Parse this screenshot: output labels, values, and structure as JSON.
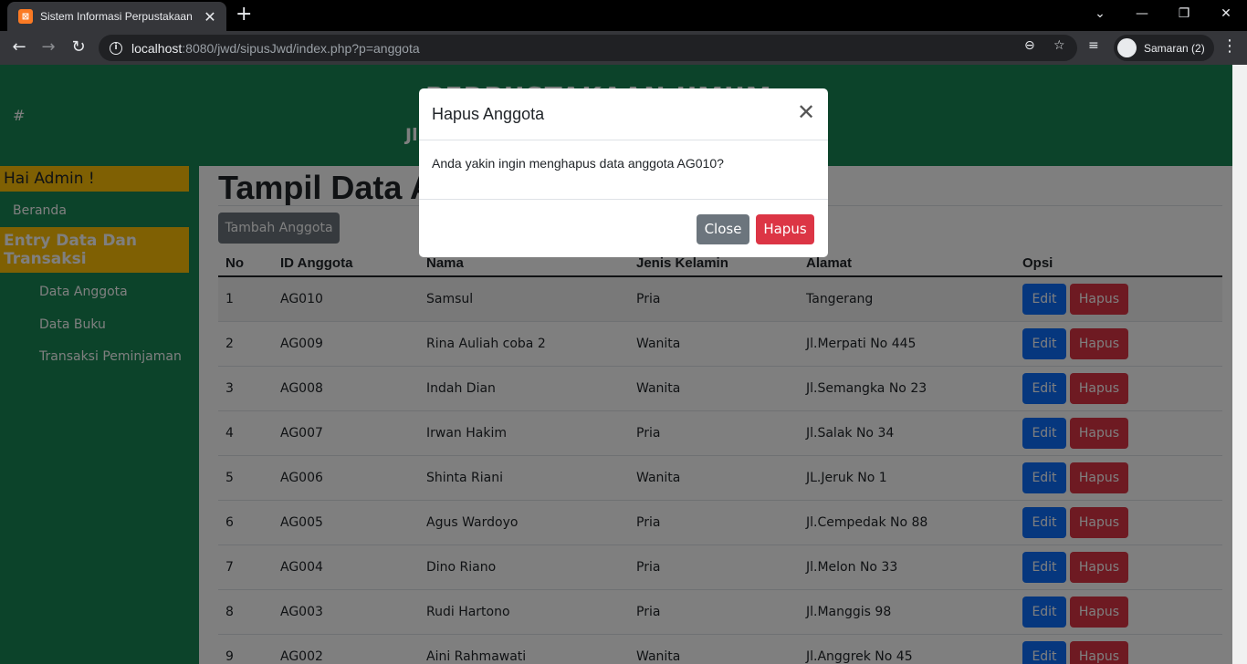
{
  "browser": {
    "tab_title": "Sistem Informasi Perpustakaan",
    "tab_favicon": "xampp-icon",
    "url_host": "localhost",
    "url_rest": ":8080/jwd/sipusJwd/index.php?p=anggota",
    "profile_name": "Samaran (2)"
  },
  "header": {
    "hash": "#",
    "title": "PERPUSTAKAAN UMUM",
    "subtitle": "Jl"
  },
  "sidebar": {
    "greeting": "Hai Admin !",
    "home": "Beranda",
    "section": "Entry Data Dan Transaksi",
    "items": [
      {
        "label": "Data Anggota"
      },
      {
        "label": "Data Buku"
      },
      {
        "label": "Transaksi Peminjaman"
      }
    ]
  },
  "main": {
    "title": "Tampil Data Anggota",
    "add_button": "Tambah Anggota",
    "columns": [
      "No",
      "ID Anggota",
      "Nama",
      "Jenis Kelamin",
      "Alamat",
      "Opsi"
    ],
    "edit_label": "Edit",
    "delete_label": "Hapus",
    "rows": [
      {
        "no": "1",
        "id": "AG010",
        "nama": "Samsul",
        "jk": "Pria",
        "alamat": "Tangerang"
      },
      {
        "no": "2",
        "id": "AG009",
        "nama": "Rina Auliah coba 2",
        "jk": "Wanita",
        "alamat": "Jl.Merpati No 445"
      },
      {
        "no": "3",
        "id": "AG008",
        "nama": "Indah Dian",
        "jk": "Wanita",
        "alamat": "Jl.Semangka No 23"
      },
      {
        "no": "4",
        "id": "AG007",
        "nama": "Irwan Hakim",
        "jk": "Pria",
        "alamat": "Jl.Salak No 34"
      },
      {
        "no": "5",
        "id": "AG006",
        "nama": "Shinta Riani",
        "jk": "Wanita",
        "alamat": "JL.Jeruk No 1"
      },
      {
        "no": "6",
        "id": "AG005",
        "nama": "Agus Wardoyo",
        "jk": "Pria",
        "alamat": "Jl.Cempedak No 88"
      },
      {
        "no": "7",
        "id": "AG004",
        "nama": "Dino Riano",
        "jk": "Pria",
        "alamat": "Jl.Melon No 33"
      },
      {
        "no": "8",
        "id": "AG003",
        "nama": "Rudi Hartono",
        "jk": "Pria",
        "alamat": "Jl.Manggis 98"
      },
      {
        "no": "9",
        "id": "AG002",
        "nama": "Aini Rahmawati",
        "jk": "Wanita",
        "alamat": "Jl.Anggrek No 45"
      }
    ]
  },
  "modal": {
    "title": "Hapus Anggota",
    "message": "Anda yakin ingin menghapus data anggota AG010?",
    "close_label": "Close",
    "confirm_label": "Hapus"
  },
  "colors": {
    "header_green": "#198754",
    "sidebar_highlight": "#ffc107",
    "edit_blue": "#0d6efd",
    "delete_red": "#dc3545",
    "secondary_grey": "#6c757d"
  }
}
